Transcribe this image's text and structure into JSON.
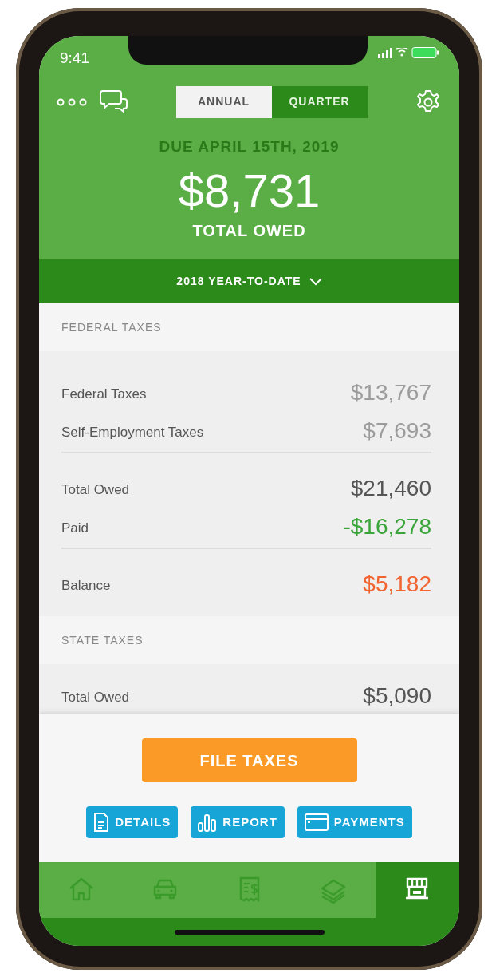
{
  "status_bar": {
    "time": "9:41"
  },
  "segments": [
    {
      "label": "ANNUAL",
      "selected": true
    },
    {
      "label": "QUARTER",
      "selected": false
    }
  ],
  "summary": {
    "due": "DUE APRIL 15TH, 2019",
    "amount": "$8,731",
    "caption": "TOTAL OWED"
  },
  "period": {
    "label": "2018 YEAR-TO-DATE"
  },
  "sections": [
    {
      "title": "FEDERAL TAXES",
      "groups": [
        [
          {
            "label": "Federal Taxes",
            "value": "$13,767",
            "kind": "muted"
          },
          {
            "label": "Self-Employment Taxes",
            "value": "$7,693",
            "kind": "muted"
          }
        ],
        [
          {
            "label": "Total Owed",
            "value": "$21,460",
            "kind": "strong"
          },
          {
            "label": "Paid",
            "value": "-$16,278",
            "kind": "credit"
          }
        ],
        [
          {
            "label": "Balance",
            "value": "$5,182",
            "kind": "due"
          }
        ]
      ]
    },
    {
      "title": "STATE TAXES",
      "groups": [
        [
          {
            "label": "Total Owed",
            "value": "$5,090",
            "kind": "strong"
          }
        ]
      ]
    }
  ],
  "primary_action": {
    "label": "FILE TAXES"
  },
  "actions": [
    {
      "label": "DETAILS"
    },
    {
      "label": "REPORT"
    },
    {
      "label": "PAYMENTS"
    }
  ],
  "tabs": [
    {
      "selected": false
    },
    {
      "selected": false
    },
    {
      "selected": false
    },
    {
      "selected": false
    },
    {
      "selected": true
    }
  ]
}
